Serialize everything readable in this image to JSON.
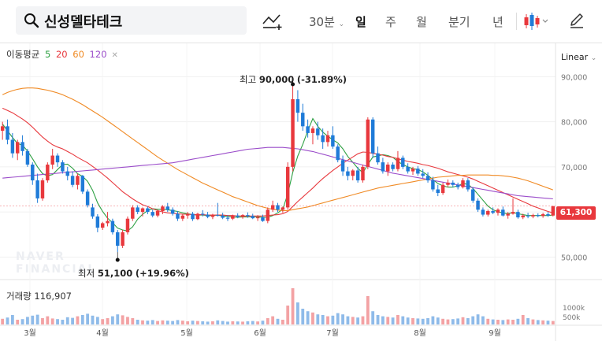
{
  "stock": {
    "name": "신성델타테크"
  },
  "toolbar": {
    "periods": [
      "30분",
      "일",
      "주",
      "월",
      "분기",
      "년"
    ],
    "active_period": "일"
  },
  "legend": {
    "title": "이동평균",
    "ma": [
      {
        "label": "5",
        "color": "#2ea043"
      },
      {
        "label": "20",
        "color": "#e8383d"
      },
      {
        "label": "60",
        "color": "#f08a24"
      },
      {
        "label": "120",
        "color": "#9b4dca"
      }
    ]
  },
  "scale_label": "Linear",
  "annotations": {
    "high": {
      "label": "최고",
      "value": "90,000",
      "pct": "(-31.89%)"
    },
    "low": {
      "label": "최저",
      "value": "51,100",
      "pct": "(+19.96%)"
    }
  },
  "current_price": "61,300",
  "volume": {
    "title": "거래량",
    "value": "116,907",
    "ticks": [
      "1000k",
      "500k"
    ]
  },
  "watermark": [
    "NAVER",
    "FINANCIAL"
  ],
  "chart_data": {
    "type": "candlestick",
    "y_ticks": [
      "90,000",
      "80,000",
      "70,000",
      "60,000",
      "50,000"
    ],
    "ylim": [
      45000,
      96000
    ],
    "x_ticks": [
      "3월",
      "4월",
      "5월",
      "6월",
      "7월",
      "8월",
      "9월"
    ],
    "colors": {
      "up": "#e8383d",
      "down": "#1f7bd8"
    },
    "candles": [
      [
        78000,
        80000,
        76000,
        79000
      ],
      [
        79000,
        80500,
        75000,
        76000
      ],
      [
        76000,
        77500,
        72000,
        73000
      ],
      [
        73000,
        76000,
        71500,
        75500
      ],
      [
        75500,
        77000,
        72500,
        73500
      ],
      [
        73500,
        74000,
        70000,
        70500
      ],
      [
        70500,
        71000,
        66000,
        67000
      ],
      [
        67000,
        68500,
        62000,
        63000
      ],
      [
        63000,
        67500,
        62500,
        67000
      ],
      [
        67000,
        71000,
        66500,
        70500
      ],
      [
        70500,
        74000,
        69500,
        72500
      ],
      [
        72500,
        73000,
        70000,
        71000
      ],
      [
        71000,
        71500,
        68500,
        69000
      ],
      [
        69000,
        70000,
        67000,
        68000
      ],
      [
        68000,
        69000,
        65500,
        66000
      ],
      [
        66000,
        68500,
        65000,
        68000
      ],
      [
        68000,
        68200,
        64000,
        64500
      ],
      [
        64500,
        65000,
        61000,
        61500
      ],
      [
        61000,
        61800,
        58500,
        59000
      ],
      [
        59000,
        59500,
        55500,
        56500
      ],
      [
        56500,
        57800,
        56000,
        57500
      ],
      [
        57500,
        60000,
        56800,
        58000
      ],
      [
        58000,
        58500,
        55000,
        55500
      ],
      [
        55500,
        56000,
        51100,
        52500
      ],
      [
        52500,
        56000,
        52000,
        55500
      ],
      [
        55500,
        59000,
        55000,
        58500
      ],
      [
        58500,
        61500,
        58000,
        61000
      ],
      [
        61000,
        61500,
        59500,
        60000
      ],
      [
        60000,
        61000,
        59000,
        60800
      ],
      [
        60800,
        61200,
        59500,
        60000
      ],
      [
        60000,
        60500,
        58800,
        59200
      ],
      [
        59200,
        60500,
        58800,
        60200
      ],
      [
        60200,
        61500,
        59500,
        61200
      ],
      [
        61200,
        62000,
        60000,
        60500
      ],
      [
        60500,
        61000,
        59200,
        59600
      ],
      [
        59600,
        60200,
        58000,
        58500
      ],
      [
        58500,
        59500,
        58000,
        59200
      ],
      [
        59200,
        60000,
        58500,
        59600
      ],
      [
        59600,
        60000,
        58000,
        58400
      ],
      [
        58400,
        59800,
        58200,
        59600
      ],
      [
        59600,
        60400,
        59000,
        59400
      ],
      [
        59400,
        60000,
        58600,
        58900
      ],
      [
        58900,
        59600,
        58400,
        59300
      ],
      [
        59300,
        62000,
        59000,
        59200
      ],
      [
        59200,
        59800,
        58400,
        58700
      ],
      [
        58700,
        59300,
        58000,
        58500
      ],
      [
        58500,
        59400,
        58200,
        59200
      ],
      [
        59200,
        59700,
        58600,
        58900
      ],
      [
        58900,
        59500,
        58500,
        59300
      ],
      [
        59300,
        59900,
        58700,
        59100
      ],
      [
        59100,
        59600,
        58400,
        58600
      ],
      [
        58600,
        59300,
        58000,
        58800
      ],
      [
        58800,
        59400,
        57800,
        58000
      ],
      [
        58000,
        61000,
        57500,
        60500
      ],
      [
        60500,
        62500,
        60000,
        61500
      ],
      [
        61500,
        62000,
        60000,
        60500
      ],
      [
        60500,
        61200,
        59800,
        61000
      ],
      [
        61000,
        71000,
        60500,
        70000
      ],
      [
        70000,
        90000,
        69000,
        85000
      ],
      [
        85000,
        87000,
        80000,
        82000
      ],
      [
        82000,
        84000,
        78000,
        79000
      ],
      [
        79000,
        80500,
        76500,
        77500
      ],
      [
        77500,
        79000,
        75000,
        78500
      ],
      [
        78500,
        80000,
        76000,
        77000
      ],
      [
        77000,
        78500,
        74000,
        75500
      ],
      [
        75500,
        78000,
        74500,
        77000
      ],
      [
        77000,
        79000,
        74000,
        74500
      ],
      [
        74500,
        75000,
        71000,
        71500
      ],
      [
        71500,
        72500,
        68000,
        69000
      ],
      [
        69000,
        70000,
        67000,
        68000
      ],
      [
        68000,
        69500,
        67000,
        69200
      ],
      [
        69200,
        70000,
        66500,
        67000
      ],
      [
        67000,
        70500,
        66500,
        70000
      ],
      [
        70000,
        81000,
        69500,
        80500
      ],
      [
        80500,
        81000,
        72000,
        73000
      ],
      [
        73000,
        74500,
        70500,
        71000
      ],
      [
        71000,
        72000,
        68500,
        69000
      ],
      [
        69000,
        71000,
        68000,
        70500
      ],
      [
        70500,
        71000,
        69000,
        69500
      ],
      [
        69500,
        73500,
        69000,
        72000
      ],
      [
        72000,
        72500,
        69500,
        70000
      ],
      [
        70000,
        70800,
        68500,
        69000
      ],
      [
        69000,
        70000,
        68200,
        69600
      ],
      [
        69600,
        70200,
        68000,
        68500
      ],
      [
        68500,
        69500,
        67500,
        68000
      ],
      [
        68000,
        68800,
        66500,
        67000
      ],
      [
        67000,
        67800,
        64500,
        65000
      ],
      [
        65000,
        66000,
        63500,
        64200
      ],
      [
        64200,
        66500,
        63800,
        66000
      ],
      [
        66000,
        67200,
        65500,
        66500
      ],
      [
        66500,
        67000,
        65500,
        66000
      ],
      [
        66000,
        66500,
        65000,
        65500
      ],
      [
        65500,
        67500,
        65200,
        67000
      ],
      [
        67000,
        67500,
        64500,
        65000
      ],
      [
        65000,
        65500,
        62000,
        62500
      ],
      [
        62500,
        63000,
        60000,
        60500
      ],
      [
        60500,
        61000,
        59000,
        59400
      ],
      [
        59400,
        60500,
        59000,
        60200
      ],
      [
        60200,
        61000,
        59500,
        59800
      ],
      [
        59800,
        60800,
        59200,
        60500
      ],
      [
        60500,
        61200,
        59000,
        59200
      ],
      [
        59200,
        60000,
        58500,
        59600
      ],
      [
        59600,
        63000,
        59400,
        60000
      ],
      [
        60000,
        60500,
        58500,
        58800
      ],
      [
        58800,
        59600,
        58400,
        59200
      ],
      [
        59200,
        59800,
        58600,
        59000
      ],
      [
        59000,
        59600,
        58600,
        59300
      ],
      [
        59300,
        59700,
        58800,
        59100
      ],
      [
        59100,
        59800,
        58700,
        59500
      ],
      [
        59500,
        60000,
        58900,
        59200
      ],
      [
        59200,
        61200,
        59000,
        61300
      ]
    ],
    "series": [
      {
        "name": "5",
        "values": [
          79500,
          78000,
          76500,
          75200,
          74800,
          73500,
          71800,
          70000,
          68500,
          68000,
          68300,
          69400,
          70500,
          70600,
          69700,
          68500,
          67900,
          66800,
          64800,
          62000,
          60100,
          58600,
          57600,
          56400,
          56000,
          55800,
          56700,
          58400,
          59500,
          60300,
          60700,
          60600,
          60600,
          60500,
          60300,
          60100,
          59800,
          59600,
          59400,
          59300,
          59300,
          59200,
          59200,
          59300,
          59100,
          59000,
          58900,
          58800,
          58900,
          58900,
          59000,
          58900,
          58800,
          58800,
          59200,
          59800,
          60600,
          64000,
          68800,
          72400,
          75000,
          78000,
          80700,
          79000,
          77700,
          76800,
          76000,
          75300,
          74000,
          72300,
          71000,
          69700,
          68700,
          70500,
          72200,
          72400,
          72700,
          72500,
          72100,
          71200,
          70500,
          70000,
          69600,
          69400,
          68900,
          68100,
          67200,
          66300,
          65800,
          65500,
          65500,
          65800,
          66300,
          66100,
          65200,
          63900,
          62600,
          61300,
          60500,
          60000,
          59800,
          59600,
          59900,
          59600,
          59400,
          59200,
          59200,
          59200,
          59200,
          59200,
          59300
        ]
      },
      {
        "name": "20",
        "values": [
          83000,
          82500,
          82000,
          81300,
          80600,
          79800,
          78800,
          77700,
          76600,
          75700,
          74900,
          74400,
          74000,
          73400,
          72800,
          72100,
          71500,
          70900,
          70100,
          69300,
          68400,
          67500,
          66500,
          65500,
          64500,
          63700,
          62900,
          62200,
          61600,
          61200,
          60700,
          60300,
          60000,
          59800,
          59700,
          59600,
          59500,
          59500,
          59400,
          59400,
          59400,
          59300,
          59300,
          59300,
          59300,
          59200,
          59200,
          59100,
          59100,
          59100,
          59100,
          59100,
          59100,
          59200,
          59300,
          59400,
          59600,
          60100,
          61200,
          62300,
          63300,
          64300,
          65300,
          66400,
          67400,
          68300,
          69200,
          70000,
          70800,
          71500,
          72200,
          72900,
          73300,
          73200,
          73000,
          72800,
          72600,
          72300,
          72100,
          71800,
          71500,
          71200,
          71000,
          70800,
          70500,
          70300,
          70000,
          69700,
          69300,
          68900,
          68600,
          68300,
          68000,
          67700,
          67300,
          66800,
          66300,
          65800,
          65300,
          64800,
          64300,
          63800,
          63300,
          62800,
          62300,
          61800,
          61300,
          60900,
          60500,
          60100,
          59800
        ]
      },
      {
        "name": "60",
        "values": [
          86000,
          86500,
          86900,
          87200,
          87400,
          87500,
          87500,
          87400,
          87200,
          87000,
          86700,
          86400,
          86000,
          85500,
          85000,
          84400,
          83800,
          83100,
          82400,
          81700,
          81000,
          80200,
          79400,
          78600,
          77800,
          77000,
          76200,
          75400,
          74600,
          73800,
          73000,
          72200,
          71500,
          70800,
          70100,
          69400,
          68800,
          68200,
          67600,
          67000,
          66400,
          65900,
          65400,
          64900,
          64400,
          63900,
          63400,
          63000,
          62600,
          62200,
          61800,
          61400,
          61100,
          60800,
          60600,
          60400,
          60300,
          60300,
          60500,
          60700,
          60900,
          61100,
          61400,
          61700,
          62000,
          62300,
          62600,
          62900,
          63200,
          63500,
          63800,
          64100,
          64400,
          64700,
          65000,
          65300,
          65500,
          65700,
          65900,
          66100,
          66300,
          66500,
          66700,
          66900,
          67100,
          67300,
          67500,
          67700,
          67800,
          67900,
          68000,
          68100,
          68100,
          68200,
          68200,
          68200,
          68200,
          68200,
          68100,
          68100,
          68000,
          67900,
          67700,
          67500,
          67200,
          66900,
          66500,
          66100,
          65700,
          65300,
          64900
        ]
      },
      {
        "name": "120",
        "values": [
          67500,
          67600,
          67700,
          67800,
          67900,
          68000,
          68100,
          68200,
          68300,
          68400,
          68500,
          68600,
          68700,
          68800,
          68900,
          69000,
          69100,
          69200,
          69300,
          69400,
          69500,
          69600,
          69700,
          69800,
          69900,
          70000,
          70100,
          70200,
          70300,
          70400,
          70500,
          70600,
          70700,
          70800,
          70900,
          71100,
          71300,
          71500,
          71700,
          71900,
          72100,
          72300,
          72500,
          72700,
          72900,
          73100,
          73300,
          73500,
          73700,
          73900,
          74000,
          74100,
          74200,
          74300,
          74300,
          74300,
          74300,
          74200,
          74100,
          74000,
          73800,
          73600,
          73400,
          73100,
          72800,
          72500,
          72200,
          71900,
          71600,
          71300,
          71000,
          70700,
          70400,
          70100,
          69800,
          69500,
          69200,
          68900,
          68600,
          68400,
          68200,
          68000,
          67800,
          67600,
          67400,
          67200,
          67000,
          66800,
          66600,
          66400,
          66200,
          66000,
          65800,
          65600,
          65400,
          65200,
          65000,
          64800,
          64600,
          64400,
          64200,
          64000,
          63800,
          63600,
          63500,
          63400,
          63300,
          63200,
          63100,
          63000,
          62900
        ]
      }
    ],
    "volume": [
      180,
      220,
      300,
      150,
      170,
      240,
      280,
      310,
      200,
      260,
      190,
      170,
      150,
      230,
      210,
      260,
      300,
      340,
      280,
      240,
      170,
      200,
      260,
      320,
      290,
      240,
      200,
      150,
      130,
      120,
      140,
      110,
      130,
      120,
      110,
      140,
      120,
      100,
      120,
      110,
      100,
      90,
      100,
      130,
      110,
      90,
      100,
      95,
      90,
      100,
      110,
      95,
      120,
      200,
      260,
      180,
      150,
      600,
      1150,
      700,
      500,
      420,
      380,
      320,
      300,
      260,
      280,
      360,
      320,
      260,
      240,
      220,
      260,
      900,
      420,
      300,
      260,
      240,
      220,
      300,
      260,
      220,
      200,
      190,
      180,
      200,
      260,
      220,
      180,
      160,
      170,
      190,
      230,
      200,
      260,
      320,
      260,
      180,
      160,
      150,
      140,
      160,
      150,
      180,
      300,
      200,
      160,
      140,
      130,
      120,
      110
    ]
  }
}
